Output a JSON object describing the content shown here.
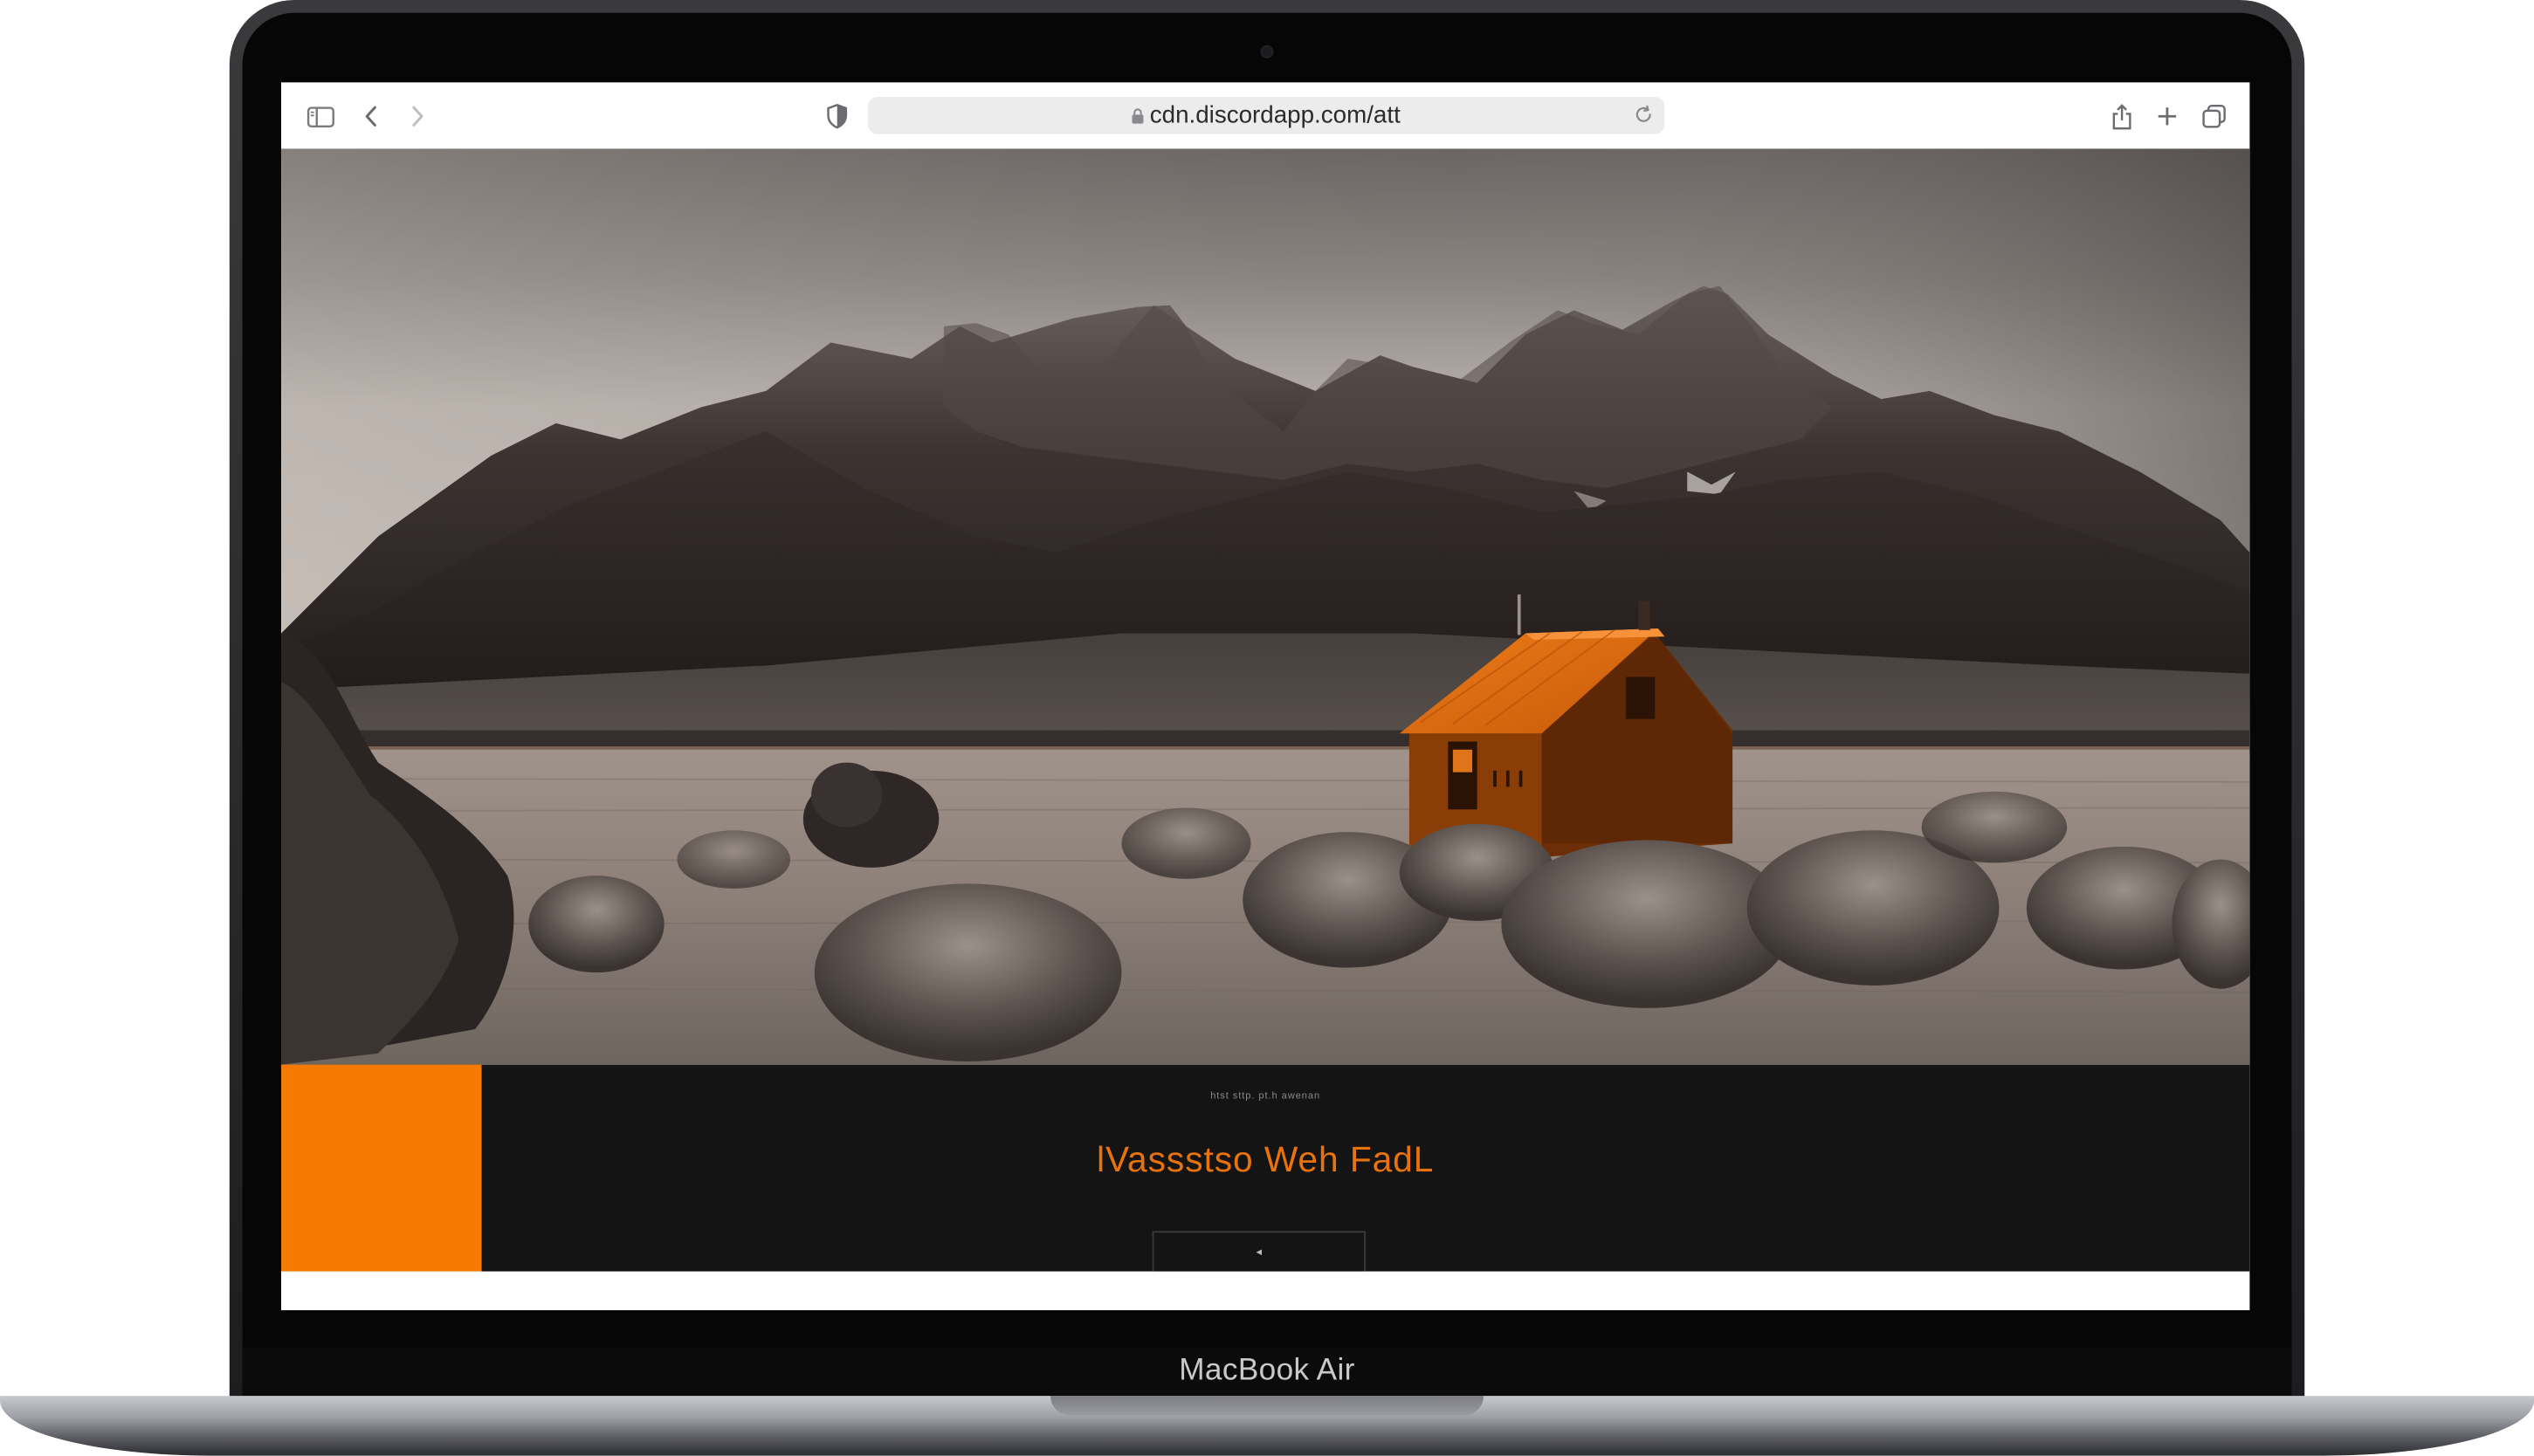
{
  "device": {
    "model_label": "MacBook Air"
  },
  "browser": {
    "url": "cdn.discordapp.com/att",
    "icons": [
      "sidebar-icon",
      "back-icon",
      "forward-icon",
      "shield-icon",
      "lock-icon",
      "reload-icon",
      "share-icon",
      "new-tab-icon",
      "tabs-overview-icon"
    ]
  },
  "page": {
    "hero": {
      "description_colors": {
        "sky": "#a9a39d",
        "mountains": "#2b2523",
        "field": "#8b7e76",
        "cabin": "#e8730c"
      }
    },
    "eyebrow": "htst sttp. pt.h awenan",
    "headline": "lVassstso Weh FadL",
    "cta_glyph": "◂",
    "accent_color": "#f77a00"
  }
}
